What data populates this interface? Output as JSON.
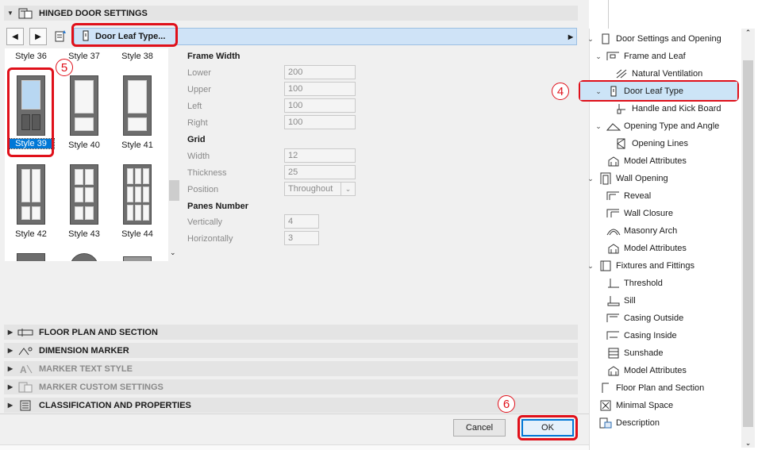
{
  "header": {
    "title": "HINGED DOOR SETTINGS"
  },
  "toolbar": {
    "leaf_type_label": "Door Leaf Type..."
  },
  "gallery": {
    "styles": [
      "Style 36",
      "Style 37",
      "Style 38",
      "Style 39",
      "Style 40",
      "Style 41",
      "Style 42",
      "Style 43",
      "Style 44"
    ],
    "selected": "Style 39"
  },
  "params": {
    "frame_width": {
      "title": "Frame Width",
      "fields": [
        {
          "label": "Lower",
          "value": "200"
        },
        {
          "label": "Upper",
          "value": "100"
        },
        {
          "label": "Left",
          "value": "100"
        },
        {
          "label": "Right",
          "value": "100"
        }
      ]
    },
    "grid": {
      "title": "Grid",
      "fields": [
        {
          "label": "Width",
          "value": "12"
        },
        {
          "label": "Thickness",
          "value": "25"
        },
        {
          "label": "Position",
          "value": "Throughout"
        }
      ]
    },
    "panes": {
      "title": "Panes Number",
      "fields": [
        {
          "label": "Vertically",
          "value": "4"
        },
        {
          "label": "Horizontally",
          "value": "3"
        }
      ]
    }
  },
  "sections": [
    {
      "label": "FLOOR PLAN AND SECTION",
      "enabled": true
    },
    {
      "label": "DIMENSION MARKER",
      "enabled": true
    },
    {
      "label": "MARKER TEXT STYLE",
      "enabled": false
    },
    {
      "label": "MARKER CUSTOM SETTINGS",
      "enabled": false
    },
    {
      "label": "CLASSIFICATION AND PROPERTIES",
      "enabled": true
    }
  ],
  "buttons": {
    "cancel": "Cancel",
    "ok": "OK"
  },
  "callouts": {
    "four": "4",
    "five": "5",
    "six": "6"
  },
  "tree": {
    "items": [
      {
        "label": "Door Settings and Opening",
        "level": 0,
        "expanded": true,
        "icon": "door-icon"
      },
      {
        "label": "Frame and Leaf",
        "level": 1,
        "expanded": true,
        "icon": "frame-icon"
      },
      {
        "label": "Natural Ventilation",
        "level": 2,
        "icon": "ventilation-icon"
      },
      {
        "label": "Door Leaf Type",
        "level": 1,
        "expanded": true,
        "icon": "leaf-icon",
        "selected": true
      },
      {
        "label": "Handle and Kick Board",
        "level": 2,
        "icon": "handle-icon"
      },
      {
        "label": "Opening Type and Angle",
        "level": 1,
        "expanded": true,
        "icon": "angle-icon"
      },
      {
        "label": "Opening Lines",
        "level": 2,
        "icon": "lines-icon"
      },
      {
        "label": "Model Attributes",
        "level": 1,
        "icon": "model-icon"
      },
      {
        "label": "Wall Opening",
        "level": 0,
        "expanded": true,
        "icon": "wall-icon"
      },
      {
        "label": "Reveal",
        "level": 1,
        "icon": "reveal-icon"
      },
      {
        "label": "Wall Closure",
        "level": 1,
        "icon": "closure-icon"
      },
      {
        "label": "Masonry Arch",
        "level": 1,
        "icon": "arch-icon"
      },
      {
        "label": "Model Attributes",
        "level": 1,
        "icon": "model-icon"
      },
      {
        "label": "Fixtures and Fittings",
        "level": 0,
        "expanded": true,
        "icon": "fixtures-icon"
      },
      {
        "label": "Threshold",
        "level": 1,
        "icon": "threshold-icon"
      },
      {
        "label": "Sill",
        "level": 1,
        "icon": "sill-icon"
      },
      {
        "label": "Casing Outside",
        "level": 1,
        "icon": "casing-icon"
      },
      {
        "label": "Casing Inside",
        "level": 1,
        "icon": "casing-icon"
      },
      {
        "label": "Sunshade",
        "level": 1,
        "icon": "sunshade-icon"
      },
      {
        "label": "Model Attributes",
        "level": 1,
        "icon": "model-icon"
      },
      {
        "label": "Floor Plan and Section",
        "level": 0,
        "icon": "plan-icon"
      },
      {
        "label": "Minimal Space",
        "level": 0,
        "icon": "space-icon"
      },
      {
        "label": "Description",
        "level": 0,
        "icon": "description-icon"
      }
    ]
  },
  "colors": {
    "accent_highlight": "#cfe3f7",
    "callout_red": "#e0101a",
    "selection_blue": "#0078d7"
  }
}
